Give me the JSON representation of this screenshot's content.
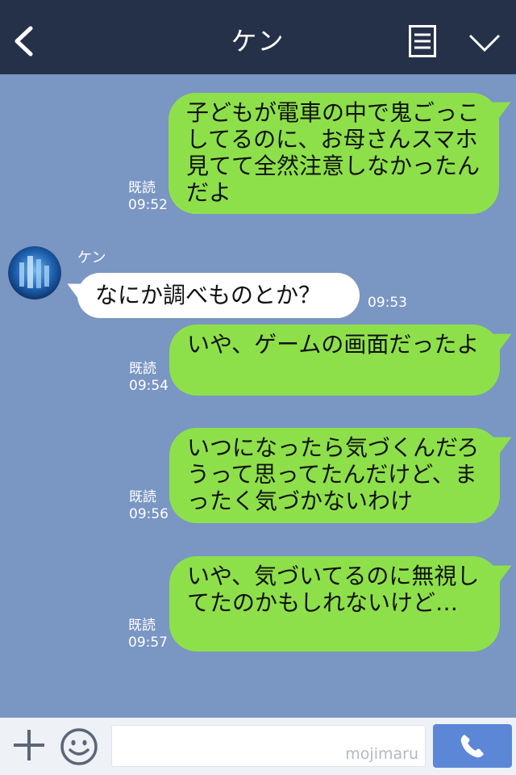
{
  "header": {
    "title": "ケン"
  },
  "messages": [
    {
      "dir": "out",
      "text": "子どもが電車の中で鬼ごっこしてるのに、お母さんスマホ見てて全然注意しなかったんだよ",
      "read": "既読",
      "time": "09:52"
    },
    {
      "dir": "in",
      "sender": "ケン",
      "text": "なにか調べものとか？",
      "time": "09:53"
    },
    {
      "dir": "out",
      "text": "いや、ゲームの画面だったよ",
      "read": "既読",
      "time": "09:54"
    },
    {
      "dir": "out",
      "text": "いつになったら気づくんだろうって思ってたんだけど、まったく気づかないわけ",
      "read": "既読",
      "time": "09:56"
    },
    {
      "dir": "out",
      "text": "いや、気づいてるのに無視してたのかもしれないけど…",
      "read": "既読",
      "time": "09:57"
    }
  ],
  "input": {
    "watermark": "mojimaru"
  },
  "colors": {
    "header_bg": "#253148",
    "chat_bg": "#7a96c3",
    "outgoing_bubble": "#8ee04a",
    "incoming_bubble": "#ffffff",
    "call_button": "#5c86d6"
  },
  "icons": [
    "back-arrow-icon",
    "note-list-icon",
    "chevron-down-icon",
    "plus-icon",
    "smile-icon",
    "phone-icon"
  ]
}
